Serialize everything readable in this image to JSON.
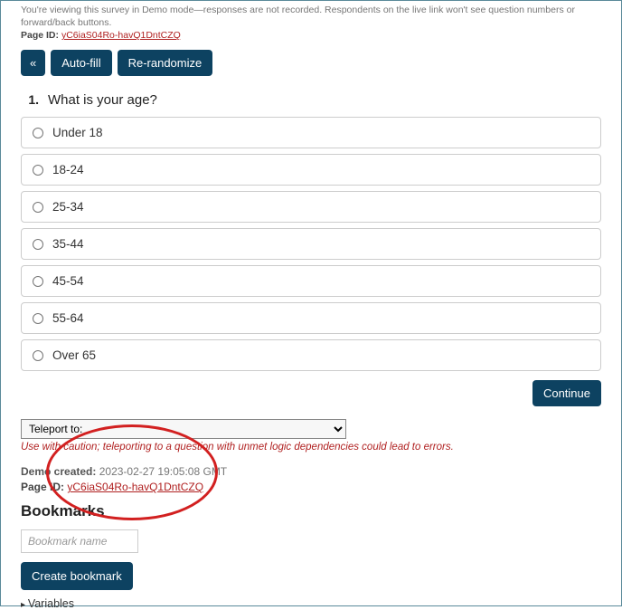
{
  "demo_notice": "You're viewing this survey in Demo mode—responses are not recorded. Respondents on the live link won't see question numbers or forward/back buttons.",
  "page_id_top": {
    "label": "Page ID:",
    "value": "yC6iaS04Ro-havQ1DntCZQ"
  },
  "buttons": {
    "back": "«",
    "autofill": "Auto-fill",
    "rerandomize": "Re-randomize",
    "continue": "Continue"
  },
  "question": {
    "number": "1.",
    "text": "What is your age?",
    "options": [
      "Under 18",
      "18-24",
      "25-34",
      "35-44",
      "45-54",
      "55-64",
      "Over 65"
    ]
  },
  "teleport": {
    "placeholder": "Teleport to:",
    "caution": "Use with caution; teleporting to a question with unmet logic dependencies could lead to errors."
  },
  "demo_created": {
    "label": "Demo created:",
    "value": "2023-02-27 19:05:08 GMT"
  },
  "page_id_bottom": {
    "label": "Page ID:",
    "value": "yC6iaS04Ro-havQ1DntCZQ"
  },
  "bookmarks": {
    "title": "Bookmarks",
    "input_placeholder": "Bookmark name",
    "create_label": "Create bookmark"
  },
  "variables_label": "Variables"
}
